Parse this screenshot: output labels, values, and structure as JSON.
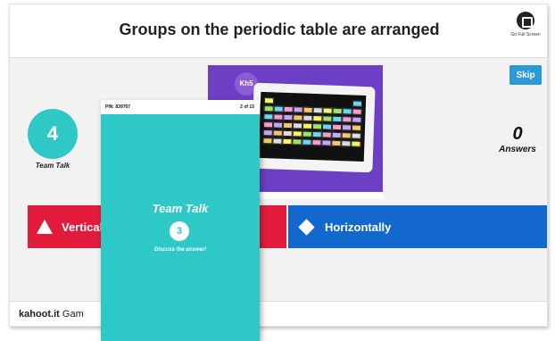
{
  "question": {
    "title": "Groups on the periodic table are arranged"
  },
  "fullscreen": {
    "label": "Go Full Screen",
    "icon": "fullscreen-icon"
  },
  "media": {
    "badge": "Kh5"
  },
  "skip": {
    "label": "Skip"
  },
  "timer": {
    "value": "4",
    "caption": "Team Talk"
  },
  "answers": {
    "count": "0",
    "label": "Answers"
  },
  "choices": [
    {
      "label": "Vertical",
      "shape": "triangle-icon",
      "color": "#e21b3c"
    },
    {
      "label": "Horizontally",
      "shape": "diamond-icon",
      "color": "#1368ce"
    }
  ],
  "footer": {
    "brand": "kahoot.it",
    "text": "Gam"
  },
  "phone": {
    "pin": "PIN: 839767",
    "progress": "2 of 15",
    "title": "Team Talk",
    "counter": "3",
    "subtitle": "Discuss the answer!"
  },
  "colors": {
    "accent": "#2ec8c6",
    "red": "#e21b3c",
    "blue": "#1368ce",
    "purple": "#6d3fc4",
    "skip": "#2d9ad8"
  }
}
